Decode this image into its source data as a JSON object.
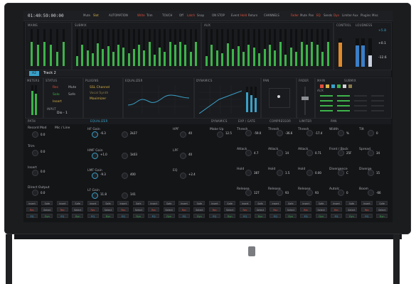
{
  "timecode": "01:40:59:00:00",
  "topbar": {
    "items": [
      "Mute",
      "Slot",
      "AUTOMATION",
      "Write",
      "Trim",
      "TOUCH",
      "Off",
      "Latch",
      "Snap",
      "ON STOP",
      "Event",
      "Hold",
      "Return",
      "CHANNELS",
      "Fader",
      "Mute",
      "Pan",
      "EQ",
      "Sends",
      "Dyn",
      "Limiter",
      "Aux",
      "Plugins",
      "Misc"
    ]
  },
  "sections": {
    "main": "MAINS",
    "submix": "SUBMIX",
    "aux": "AUX",
    "control": "CONTROL",
    "loudness": "LOUDNESS",
    "meters": "METERS",
    "status": "STATUS",
    "plugins": "PLUGINS",
    "equalizer": "EQUALIZER",
    "dynamics": "DYNAMICS",
    "pan": "PAN",
    "fader": "FADER",
    "main2": "MAIN",
    "submix2": "SUBMIX",
    "aux2": "AUX"
  },
  "loudness": {
    "v1": "+5.8",
    "v2": "+0.1",
    "v3": "-12.6"
  },
  "track": {
    "id": "A2",
    "name": "Track 2"
  },
  "status": {
    "rec": "Rec",
    "mute": "Mute",
    "solo": "Solo",
    "safe": "Safe",
    "insert": "Insert",
    "input": "INPUT",
    "input_val": "Dio - 1"
  },
  "plugins": [
    "SSL Channel",
    "Vocal Synth",
    "Maximizer"
  ],
  "lower_headers": [
    "PATH",
    "EQUALIZER",
    "DYNAMICS",
    "EXP / GATE",
    "COMPRESSOR",
    "LIMITER",
    "PAN"
  ],
  "path": [
    "Record Mod",
    "Mic / Line",
    "Trim",
    "Insert",
    "Direct Output"
  ],
  "path_vals": [
    "0.0",
    "0.0",
    "0.0",
    "0.0"
  ],
  "eq_bands": [
    {
      "label": "HF Gain",
      "val": "-6.3",
      "freq": "2k27",
      "q": "Q"
    },
    {
      "label": "HMF Gain",
      "val": "+1.0",
      "freq": "1k03",
      "q": "Q"
    },
    {
      "label": "LMF Gain",
      "val": "-9.3",
      "freq": "400",
      "q": "Q"
    },
    {
      "label": "LF Gain",
      "val": "11.8",
      "freq": "141",
      "q": "Q"
    }
  ],
  "filters": {
    "hpf": "HPF",
    "hpf_val": "40",
    "lpf": "LPF",
    "lpf_val": "40",
    "eq": "EQ",
    "eq_val": "+2.4"
  },
  "dynamics": {
    "makeup": "Make Up",
    "makeup_val": "12.5"
  },
  "gate": [
    {
      "l": "Thresh",
      "v": "-59.0"
    },
    {
      "l": "Attack",
      "v": "4.7"
    },
    {
      "l": "Hold",
      "v": "387"
    },
    {
      "l": "Release",
      "v": "127"
    }
  ],
  "comp": [
    {
      "l": "Thresh",
      "v": "-36.6"
    },
    {
      "l": "Attack",
      "v": "14"
    },
    {
      "l": "Hold",
      "v": "1.5"
    },
    {
      "l": "Release",
      "v": "93"
    }
  ],
  "limiter": [
    {
      "l": "Thresh",
      "v": "-17.4"
    },
    {
      "l": "Attack",
      "v": "0.71"
    },
    {
      "l": "Hold",
      "v": "0.00"
    },
    {
      "l": "Release",
      "v": "93"
    }
  ],
  "pan": [
    {
      "l": "Width",
      "v": "%"
    },
    {
      "l": "Front / Back",
      "v": "25F"
    },
    {
      "l": "Divergence",
      "v": "C"
    },
    {
      "l": "Autolc",
      "v": "0"
    }
  ],
  "pan2": [
    {
      "l": "Tilt",
      "v": "0"
    },
    {
      "l": "Spread",
      "v": "34"
    },
    {
      "l": "Diverge",
      "v": "15"
    },
    {
      "l": "Boom",
      "v": "-66"
    }
  ],
  "bottom_row1": [
    "Insert",
    "Safe",
    "Insert",
    "Safe",
    "Insert",
    "Safe",
    "Insert",
    "Safe",
    "Insert",
    "Safe",
    "Insert",
    "Safe",
    "Insert",
    "Safe",
    "Insert",
    "Safe",
    "Insert",
    "Safe",
    "Insert",
    "Safe",
    "Insert",
    "Safe",
    "Insert",
    "Safe"
  ],
  "bottom_row2": [
    "Rec",
    "Select",
    "Rec",
    "Select",
    "Rec",
    "Select",
    "Rec",
    "Select",
    "Rec",
    "Select",
    "Rec",
    "Select",
    "Rec",
    "Select",
    "Rec",
    "Select",
    "Rec",
    "Select",
    "Rec",
    "Select",
    "Rec",
    "Select",
    "Rec",
    "Select"
  ],
  "bottom_row3": [
    "EQ",
    "Dyn",
    "EQ",
    "Dyn",
    "EQ",
    "Dyn",
    "EQ",
    "Dyn",
    "EQ",
    "Dyn",
    "EQ",
    "Dyn",
    "EQ",
    "Dyn",
    "EQ",
    "Dyn",
    "EQ",
    "Dyn",
    "EQ",
    "Dyn",
    "EQ",
    "Dyn",
    "EQ",
    "Dyn"
  ],
  "accent_colors": {
    "green": "#3db34a",
    "blue": "#3aa0c8",
    "red": "#e0503c",
    "yellow": "#d7b24a",
    "orange": "#e08a2a"
  }
}
